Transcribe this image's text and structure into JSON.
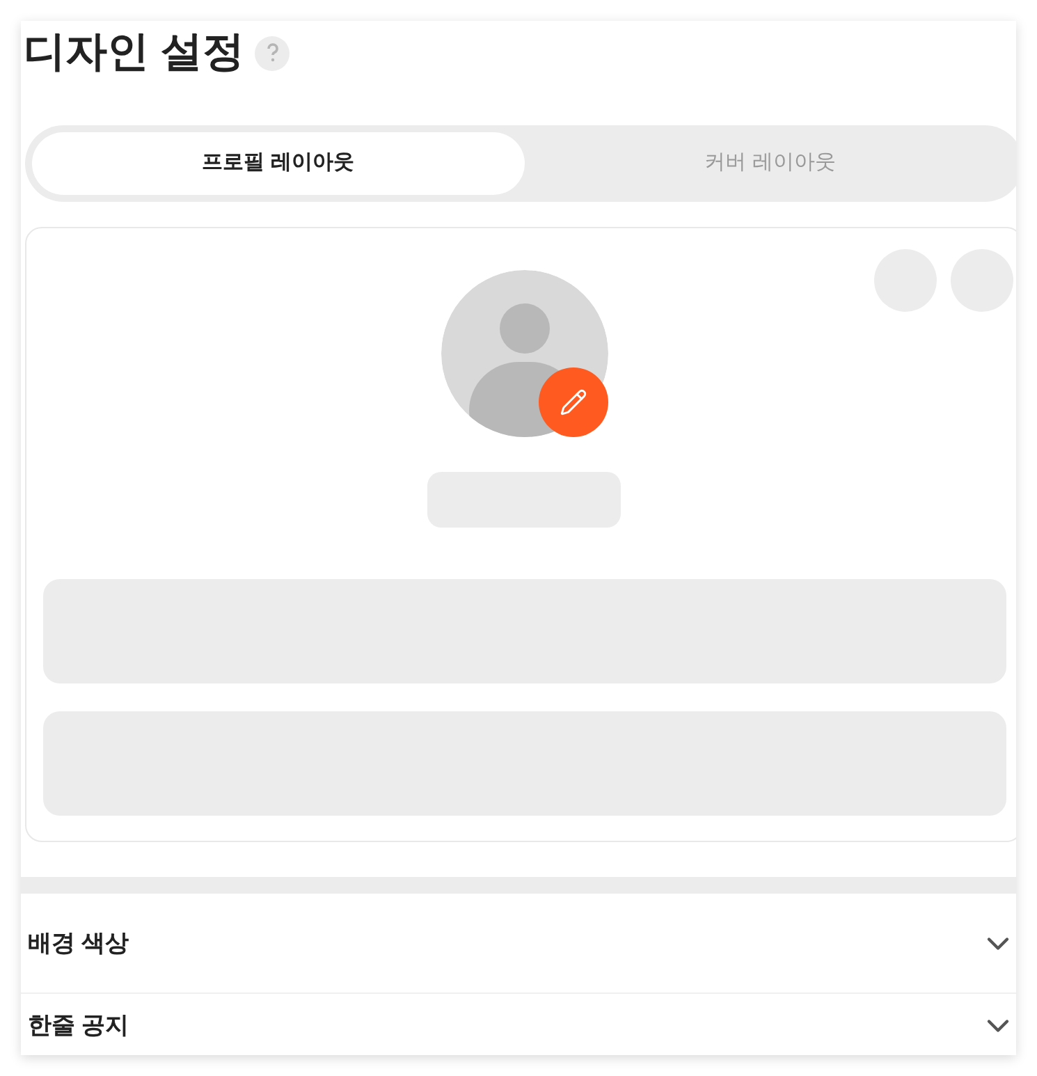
{
  "title": "디자인 설정",
  "tabs": [
    {
      "label": "프로필 레이아웃",
      "selected": true
    },
    {
      "label": "커버 레이아웃",
      "selected": false
    }
  ],
  "sections": [
    {
      "label": "배경 색상",
      "expanded": false
    },
    {
      "label": "한줄 공지",
      "expanded": false
    }
  ]
}
